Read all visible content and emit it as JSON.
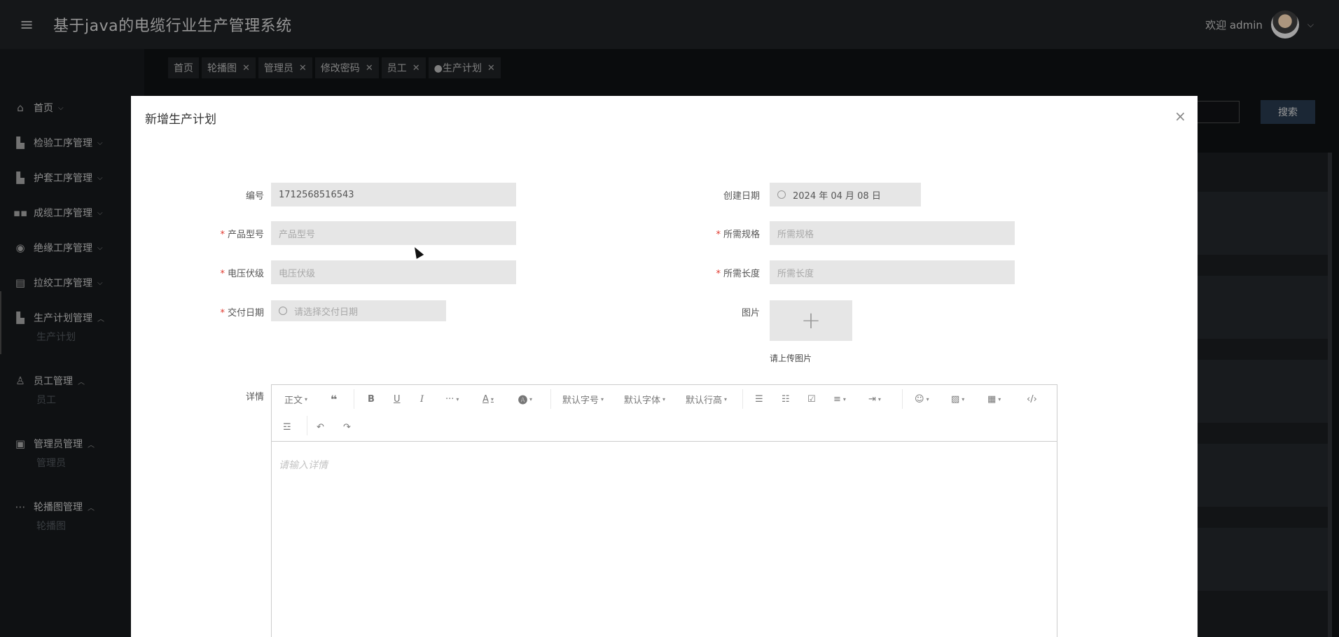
{
  "header": {
    "title": "基于java的电缆行业生产管理系统",
    "welcome": "欢迎 admin"
  },
  "sidebar": {
    "items": [
      {
        "label": "首页",
        "icon": "home-icon"
      },
      {
        "label": "检验工序管理",
        "icon": "dashboard-icon"
      },
      {
        "label": "护套工序管理",
        "icon": "dashboard-icon"
      },
      {
        "label": "成缆工序管理",
        "icon": "grid-icon"
      },
      {
        "label": "绝缘工序管理",
        "icon": "record-icon"
      },
      {
        "label": "拉绞工序管理",
        "icon": "layout-icon"
      },
      {
        "label": "生产计划管理",
        "icon": "dashboard-icon"
      },
      {
        "label": "员工管理",
        "icon": "user-icon"
      },
      {
        "label": "管理员管理",
        "icon": "gift-icon"
      },
      {
        "label": "轮播图管理",
        "icon": "more-icon"
      }
    ],
    "subs": {
      "plan": "生产计划",
      "staff": "员工",
      "admin": "管理员",
      "carousel": "轮播图"
    }
  },
  "tabs": [
    {
      "label": "首页",
      "closable": false
    },
    {
      "label": "轮播图",
      "closable": true
    },
    {
      "label": "管理员",
      "closable": true
    },
    {
      "label": "修改密码",
      "closable": true
    },
    {
      "label": "员工",
      "closable": true
    },
    {
      "label": "●生产计划",
      "closable": true
    }
  ],
  "background": {
    "search_button": "搜索"
  },
  "modal": {
    "title": "新增生产计划",
    "fields": {
      "code": {
        "label": "编号",
        "value": "1712568516543"
      },
      "created": {
        "label": "创建日期",
        "value": "2024 年 04 月 08 日"
      },
      "model": {
        "label": "产品型号",
        "placeholder": "产品型号",
        "required": true
      },
      "spec": {
        "label": "所需规格",
        "placeholder": "所需规格",
        "required": true
      },
      "voltage": {
        "label": "电压伏级",
        "placeholder": "电压伏级",
        "required": true
      },
      "length": {
        "label": "所需长度",
        "placeholder": "所需长度",
        "required": true
      },
      "delivery": {
        "label": "交付日期",
        "placeholder": "请选择交付日期",
        "required": true
      },
      "image": {
        "label": "图片",
        "hint": "请上传图片"
      },
      "detail": {
        "label": "详情",
        "placeholder": "请输入详情"
      }
    },
    "toolbar": {
      "paragraph": "正文",
      "font_size": "默认字号",
      "font_family": "默认字体",
      "line_height": "默认行高"
    }
  }
}
